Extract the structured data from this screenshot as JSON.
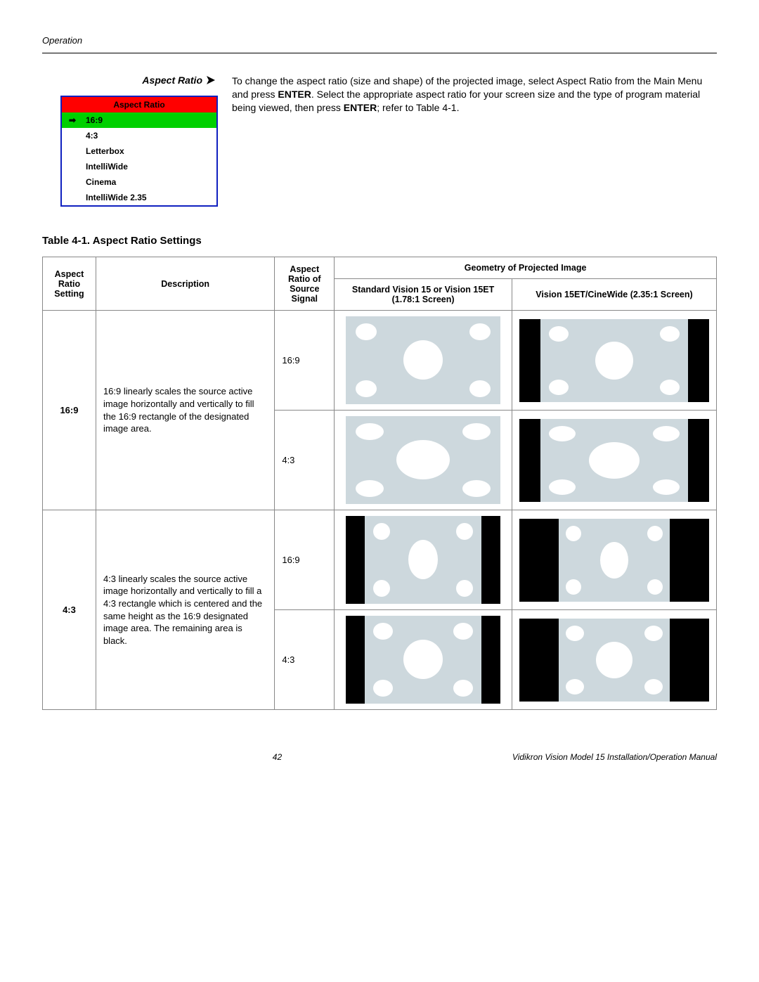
{
  "header": {
    "section": "Operation"
  },
  "side": {
    "title": "Aspect Ratio",
    "menu_header": "Aspect Ratio",
    "menu_items": [
      "16:9",
      "4:3",
      "Letterbox",
      "IntelliWide",
      "Cinema",
      "IntelliWide 2.35"
    ],
    "selected_index": 0
  },
  "intro": {
    "line1a": "To change the aspect ratio (size and shape) of the projected image, select Aspect Ratio from the Main Menu and press ",
    "enter1": "ENTER",
    "line1b": ". Select the appropriate aspect ratio for your screen size and the type of program material being viewed, then press ",
    "enter2": "ENTER",
    "line1c": "; refer to Table 4-1."
  },
  "table_title": "Table 4-1. Aspect Ratio Settings",
  "columns": {
    "c1": "Aspect Ratio Setting",
    "c2": "Description",
    "c3": "Aspect Ratio of Source Signal",
    "c4_top": "Geometry of Projected Image",
    "c4a": "Standard Vision 15 or Vision 15ET (1.78:1 Screen)",
    "c4b": "Vision 15ET/CineWide (2.35:1 Screen)"
  },
  "rows": [
    {
      "setting": "16:9",
      "desc": "16:9 linearly scales the source active image horizontally and vertically to fill the 16:9 rectangle of the designated image area.",
      "sig1": "16:9",
      "sig2": "4:3"
    },
    {
      "setting": "4:3",
      "desc": "4:3 linearly scales the source active image horizontally and vertically to fill a 4:3 rectangle which is centered and the same height as the 16:9 designated image area. The remaining area is black.",
      "sig1": "16:9",
      "sig2": "4:3"
    }
  ],
  "footer": {
    "page": "42",
    "source": "Vidikron Vision Model 15 Installation/Operation Manual"
  }
}
